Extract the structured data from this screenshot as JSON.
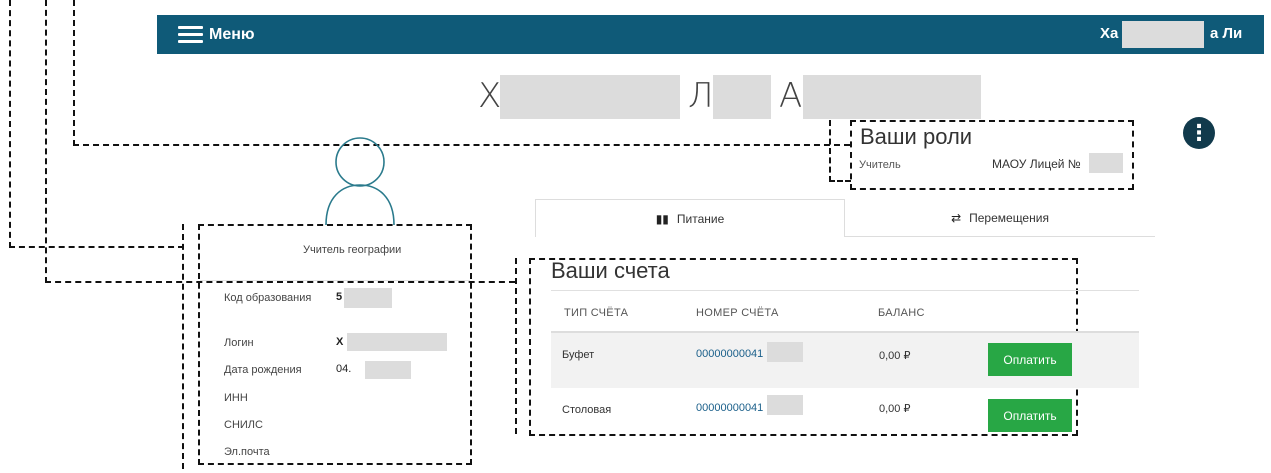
{
  "header": {
    "menu_label": "Меню",
    "user_name_start": "Ха",
    "user_name_end": "а Ли"
  },
  "profile": {
    "name_letters": [
      "Х",
      "Л",
      "А"
    ],
    "subject": "Учитель географии",
    "fields": [
      {
        "label": "Код образования",
        "value": "5"
      },
      {
        "label": "Логин",
        "value": "Х"
      },
      {
        "label": "Дата рождения",
        "value": "04."
      },
      {
        "label": "ИНН",
        "value": ""
      },
      {
        "label": "СНИЛС",
        "value": ""
      },
      {
        "label": "Эл.почта",
        "value": ""
      }
    ]
  },
  "roles": {
    "title": "Ваши роли",
    "role": "Учитель",
    "organization": "МАОУ Лицей №"
  },
  "tabs": [
    {
      "label": "Питание",
      "icon": "fork-knife-icon",
      "active": true
    },
    {
      "label": "Перемещения",
      "icon": "transfer-arrows-icon",
      "active": false
    }
  ],
  "accounts": {
    "title": "Ваши счета",
    "columns": [
      "ТИП СЧЁТА",
      "НОМЕР СЧЁТА",
      "БАЛАНС"
    ],
    "rows": [
      {
        "type": "Буфет",
        "number": "00000000041",
        "balance": "0,00 ₽",
        "action": "Оплатить"
      },
      {
        "type": "Столовая",
        "number": "00000000041",
        "balance": "0,00 ₽",
        "action": "Оплатить"
      }
    ]
  },
  "colors": {
    "header_bg": "#0f5a78",
    "pay_button": "#28a745",
    "options_button": "#113a4c"
  }
}
